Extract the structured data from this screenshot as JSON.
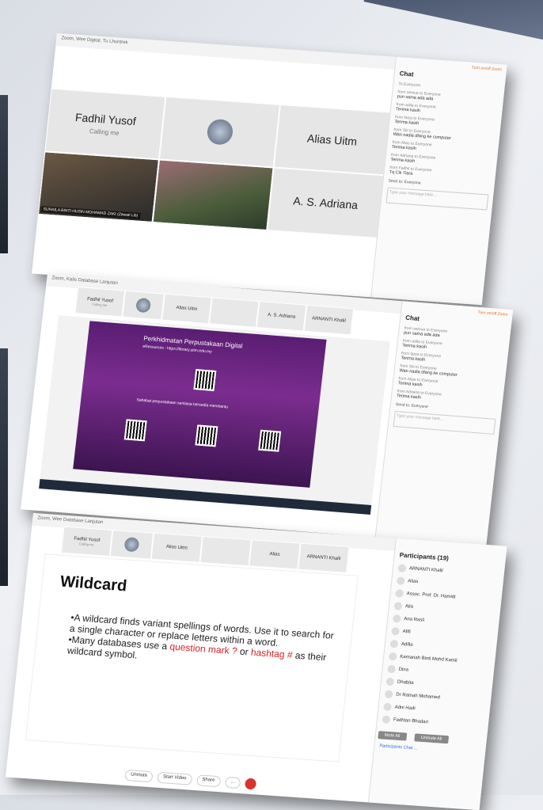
{
  "screens": [
    {
      "window_title": "Zoom, Wee Digital, Tu Lhuntrek",
      "tiles": [
        {
          "name": "Fadhil Yusof",
          "sub": "Calling me"
        },
        {
          "name": "Alias Uitm"
        },
        {
          "name": "A. S. Adriana"
        }
      ],
      "camera_caption": "SUHAILA BINTI HUSIN MOHAMAD ZAKI (Zawati Lib)",
      "chat": {
        "title": "Chat",
        "top_link": "Turn on/off Zoom",
        "messages": [
          {
            "from": "To Everyone",
            "text": ""
          },
          {
            "from": "from semua to Everyone",
            "text": "pun sama ada ada"
          },
          {
            "from": "from adila to Everyone",
            "text": "Terima kasih"
          },
          {
            "from": "from faiza to Everyone",
            "text": "Terima kasih"
          },
          {
            "from": "from Siti to Everyone",
            "text": "Wan nadia dfang ke computer"
          },
          {
            "from": "from Alias to Everyone",
            "text": "Terima kasih"
          },
          {
            "from": "from Adriana to Everyone",
            "text": "Terima kasih"
          },
          {
            "from": "from Fadhil to Everyone",
            "text": "Tq Cik Tiara"
          }
        ],
        "send_to": "Send to: Everyone",
        "placeholder": "Type your message here..."
      }
    },
    {
      "window_title": "Zoom, Kalis Database Lanjutan",
      "strip": [
        {
          "name": "Fadhil Yusof",
          "sub": "Calling me"
        },
        {
          "name": ""
        },
        {
          "name": "Alias Uitm"
        },
        {
          "name": ""
        },
        {
          "name": "A. S. Adriana"
        },
        {
          "name": "ARNANTI Khalil"
        }
      ],
      "poster": {
        "heading": "Perkhidmatan Perpustakaan Digital",
        "line2": "eResources : https://library.uitm.edu.my",
        "footer": "Sahabat perpustakaan sentiasa bersedia membantu"
      },
      "chat": {
        "title": "Chat",
        "top_link": "Turn on/off Zoom",
        "send_to": "Send to: Everyone",
        "placeholder": "Type your message here..."
      }
    },
    {
      "window_title": "Zoom, Wee Database Lanjutan",
      "strip": [
        {
          "name": "Fadhil Yusof",
          "sub": "Calling me"
        },
        {
          "name": ""
        },
        {
          "name": "Alias Uitm"
        },
        {
          "name": ""
        },
        {
          "name": "Alias"
        },
        {
          "name": "ARNANTI Khalil"
        }
      ],
      "slide": {
        "title": "Wildcard",
        "b1": "•A wildcard finds variant spellings of words. Use it to search for a single character or replace letters within a word.",
        "b2_pre": "•Many databases use a ",
        "b2_q": "question mark ?",
        "b2_mid": " or ",
        "b2_h": "hashtag #",
        "b2_post": " as their wildcard symbol."
      },
      "controls": [
        "Unmute",
        "Start Video",
        "Share",
        "..."
      ],
      "participants": {
        "title": "Participants (19)",
        "list": [
          "ARNANTI Khalil",
          "Alias",
          "Assoc. Prof. Dr. Hamidi",
          "Alia",
          "Ana Rasli",
          "Afifi",
          "Adilla",
          "Kamariah Binti Mohd Kamil",
          "Dina",
          "Dhabita",
          "Dr Ratnah Mohamed",
          "Adni Hadi",
          "Fadhlan Bhadari"
        ],
        "buttons": [
          "Mute All",
          "Unmute All"
        ],
        "footer": [
          "Participants",
          "Chat",
          "..."
        ]
      }
    }
  ]
}
